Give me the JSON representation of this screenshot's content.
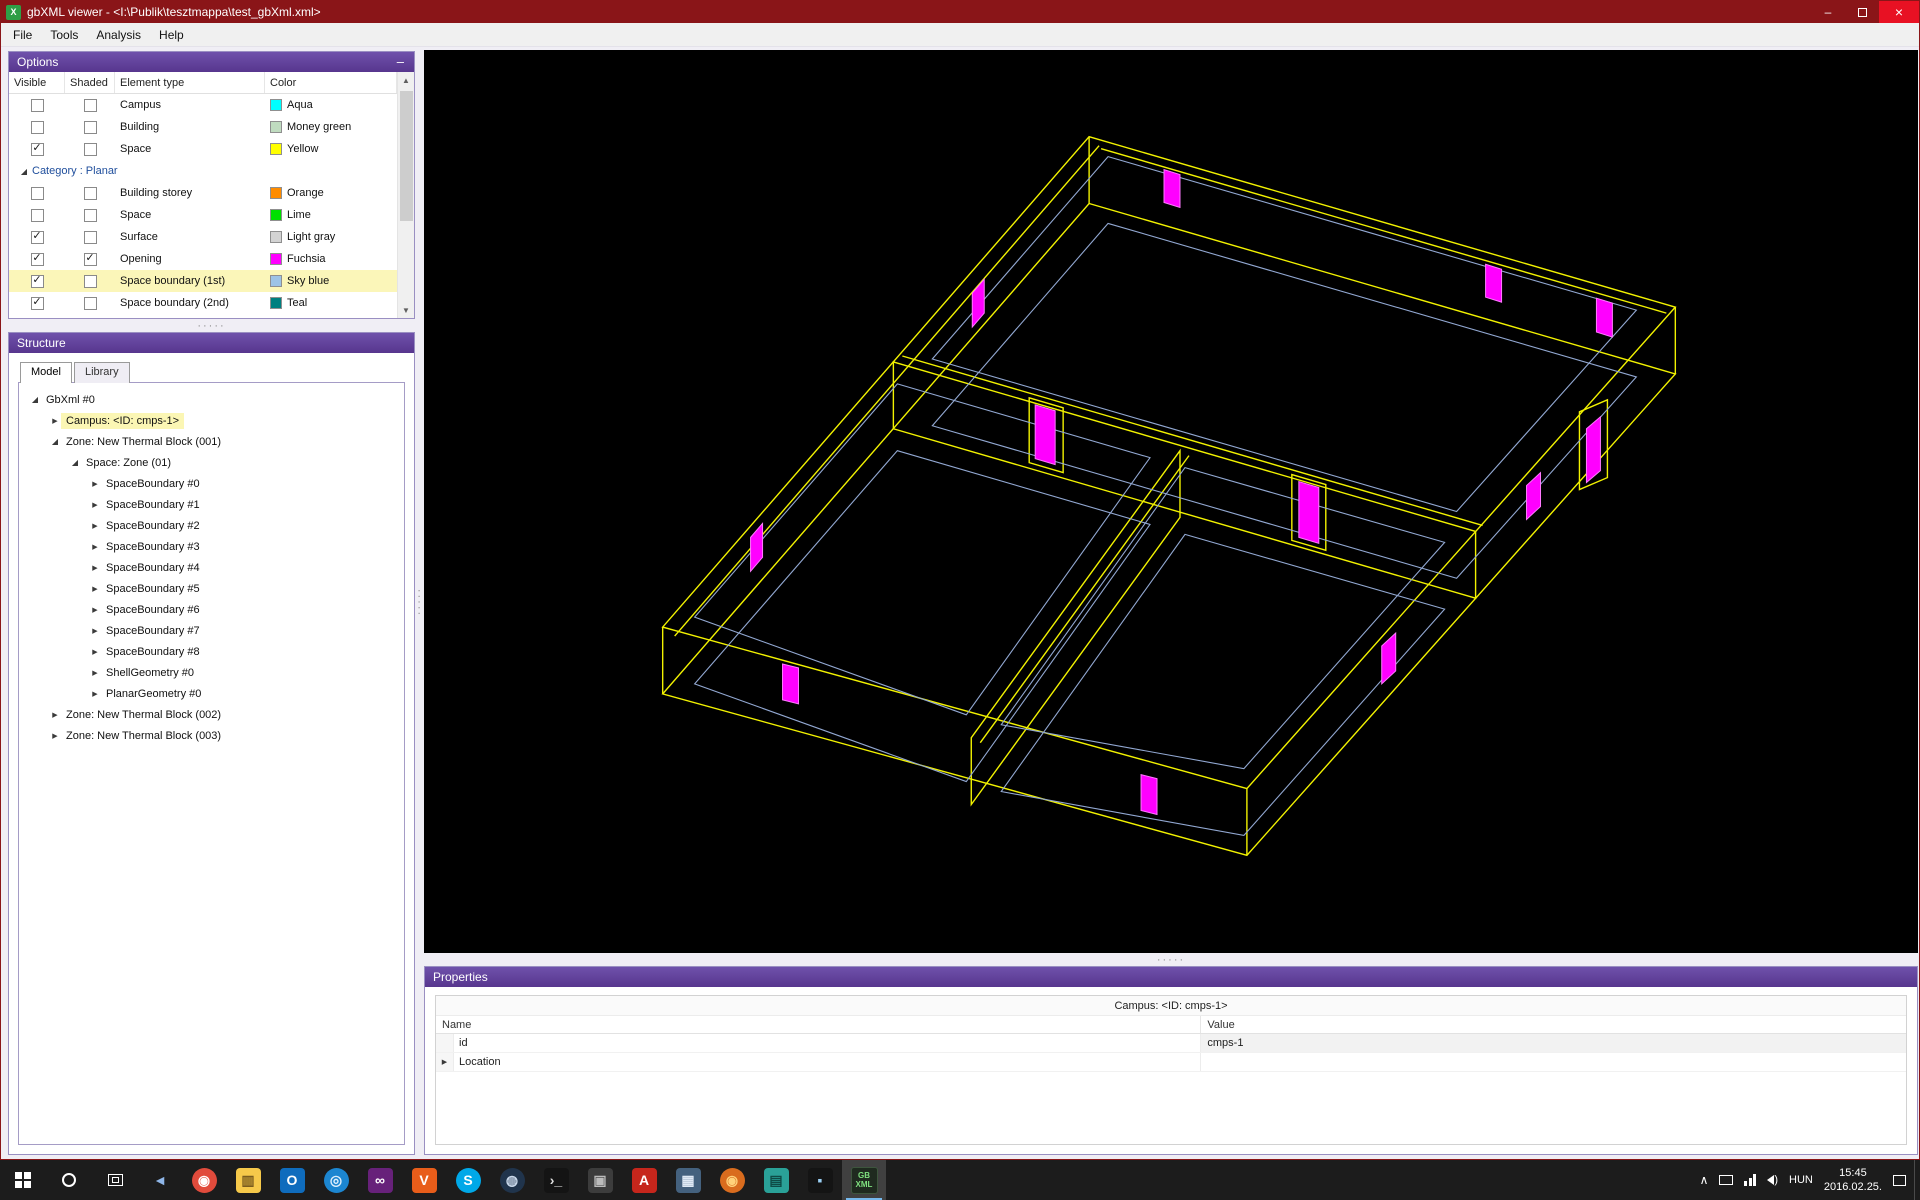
{
  "window": {
    "title": "gbXML viewer - <I:\\Publik\\tesztmappa\\test_gbXml.xml>",
    "icon_label": "X",
    "controls": {
      "minimize": "–",
      "close": "×"
    }
  },
  "menubar": {
    "items": [
      "File",
      "Tools",
      "Analysis",
      "Help"
    ]
  },
  "options_panel": {
    "title": "Options",
    "collapse_glyph": "–",
    "columns": [
      "Visible",
      "Shaded",
      "Element type",
      "Color"
    ],
    "rows": [
      {
        "type": "item",
        "visible": false,
        "shaded": false,
        "element": "Campus",
        "color_name": "Aqua",
        "color": "#00FFFF"
      },
      {
        "type": "item",
        "visible": false,
        "shaded": false,
        "element": "Building",
        "color_name": "Money green",
        "color": "#C0DCC0"
      },
      {
        "type": "item",
        "visible": true,
        "shaded": false,
        "element": "Space",
        "color_name": "Yellow",
        "color": "#FFFF00"
      },
      {
        "type": "category",
        "label": "Category : Planar"
      },
      {
        "type": "item",
        "visible": false,
        "shaded": false,
        "element": "Building storey",
        "color_name": "Orange",
        "color": "#FF8C00"
      },
      {
        "type": "item",
        "visible": false,
        "shaded": false,
        "element": "Space",
        "color_name": "Lime",
        "color": "#00E000"
      },
      {
        "type": "item",
        "visible": true,
        "shaded": false,
        "element": "Surface",
        "color_name": "Light gray",
        "color": "#D3D3D3"
      },
      {
        "type": "item",
        "visible": true,
        "shaded": true,
        "element": "Opening",
        "color_name": "Fuchsia",
        "color": "#FF00FF"
      },
      {
        "type": "item",
        "visible": true,
        "shaded": false,
        "element": "Space boundary (1st)",
        "color_name": "Sky blue",
        "color": "#9DC3E6",
        "selected": true
      },
      {
        "type": "item",
        "visible": true,
        "shaded": false,
        "element": "Space boundary (2nd)",
        "color_name": "Teal",
        "color": "#008080"
      }
    ]
  },
  "structure_panel": {
    "title": "Structure",
    "tabs": [
      {
        "label": "Model",
        "active": true
      },
      {
        "label": "Library",
        "active": false
      }
    ],
    "tree": [
      {
        "label": "GbXml #0",
        "level": 0,
        "state": "expanded"
      },
      {
        "label": "Campus: <ID: cmps-1>",
        "level": 1,
        "state": "collapsed",
        "selected": true
      },
      {
        "label": "Zone: New Thermal Block (001)",
        "level": 1,
        "state": "expanded"
      },
      {
        "label": "Space: Zone (01)",
        "level": 2,
        "state": "expanded"
      },
      {
        "label": "SpaceBoundary #0",
        "level": 3,
        "state": "collapsed"
      },
      {
        "label": "SpaceBoundary #1",
        "level": 3,
        "state": "collapsed"
      },
      {
        "label": "SpaceBoundary #2",
        "level": 3,
        "state": "collapsed"
      },
      {
        "label": "SpaceBoundary #3",
        "level": 3,
        "state": "collapsed"
      },
      {
        "label": "SpaceBoundary #4",
        "level": 3,
        "state": "collapsed"
      },
      {
        "label": "SpaceBoundary #5",
        "level": 3,
        "state": "collapsed"
      },
      {
        "label": "SpaceBoundary #6",
        "level": 3,
        "state": "collapsed"
      },
      {
        "label": "SpaceBoundary #7",
        "level": 3,
        "state": "collapsed"
      },
      {
        "label": "SpaceBoundary #8",
        "level": 3,
        "state": "collapsed"
      },
      {
        "label": "ShellGeometry #0",
        "level": 3,
        "state": "collapsed"
      },
      {
        "label": "PlanarGeometry #0",
        "level": 3,
        "state": "collapsed"
      },
      {
        "label": "Zone: New Thermal Block (002)",
        "level": 1,
        "state": "collapsed"
      },
      {
        "label": "Zone: New Thermal Block (003)",
        "level": 1,
        "state": "collapsed"
      }
    ]
  },
  "viewport": {
    "colors": {
      "space_outline": "#F2F200",
      "space_boundary": "#92A8D2",
      "opening": "#FF00FF"
    }
  },
  "properties_panel": {
    "title": "Properties",
    "object_header": "Campus: <ID: cmps-1>",
    "columns": [
      "Name",
      "Value"
    ],
    "rows": [
      {
        "name": "id",
        "value": "cmps-1",
        "expandable": false
      },
      {
        "name": "Location",
        "value": "",
        "expandable": true
      }
    ]
  },
  "taskbar": {
    "apps": [
      {
        "name": "mail-app",
        "glyph": "◄",
        "fg": "#8fb6e8",
        "bg": "none",
        "shape": "plain"
      },
      {
        "name": "chrome",
        "glyph": "◉",
        "fg": "#ffffff",
        "bg": "#e14b3c",
        "shape": "circle"
      },
      {
        "name": "file-explorer",
        "glyph": "▥",
        "fg": "#7a5c1e",
        "bg": "#f6c94a",
        "shape": "tile"
      },
      {
        "name": "outlook",
        "glyph": "O",
        "fg": "#ffffff",
        "bg": "#0f6cbd",
        "shape": "tile"
      },
      {
        "name": "browser",
        "glyph": "◎",
        "fg": "#dfeffc",
        "bg": "#1c86d1",
        "shape": "circle"
      },
      {
        "name": "visual-studio",
        "glyph": "∞",
        "fg": "#ffffff",
        "bg": "#67217a",
        "shape": "tile"
      },
      {
        "name": "vlc",
        "glyph": "V",
        "fg": "#ffffff",
        "bg": "#e85d1a",
        "shape": "tile"
      },
      {
        "name": "skype",
        "glyph": "S",
        "fg": "#ffffff",
        "bg": "#00a8e8",
        "shape": "circle"
      },
      {
        "name": "steam",
        "glyph": "◍",
        "fg": "#c9d8ea",
        "bg": "#20344c",
        "shape": "circle"
      },
      {
        "name": "command-prompt",
        "glyph": "›_",
        "fg": "#e0e0e0",
        "bg": "#141414",
        "shape": "tile"
      },
      {
        "name": "app-dark",
        "glyph": "▣",
        "fg": "#bbbbbb",
        "bg": "#3c3c3c",
        "shape": "tile"
      },
      {
        "name": "acrobat",
        "glyph": "A",
        "fg": "#ffffff",
        "bg": "#c6261c",
        "shape": "tile"
      },
      {
        "name": "save-tool",
        "glyph": "▦",
        "fg": "#dfe9f5",
        "bg": "#44617e",
        "shape": "tile"
      },
      {
        "name": "firefox",
        "glyph": "◉",
        "fg": "#ffd27a",
        "bg": "#d96c1e",
        "shape": "circle"
      },
      {
        "name": "folder-app",
        "glyph": "▤",
        "fg": "#0e4b46",
        "bg": "#2aa198",
        "shape": "tile"
      },
      {
        "name": "photos-app",
        "glyph": "▪",
        "fg": "#9bd0f5",
        "bg": "#141414",
        "shape": "tile"
      }
    ],
    "active_app": {
      "name": "gbxml-viewer",
      "line1": "GB",
      "line2": "XML"
    },
    "tray": {
      "chevron": "∧",
      "language": "HUN",
      "time": "15:45",
      "date": "2016.02.25."
    }
  }
}
